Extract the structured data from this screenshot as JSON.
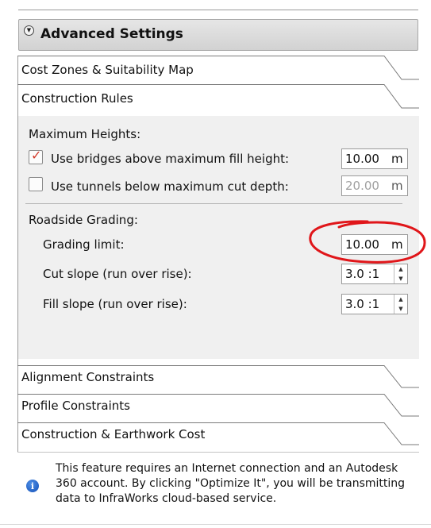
{
  "advanced_settings": {
    "title": "Advanced Settings",
    "toggle_icon": "double-chevron-down-icon"
  },
  "sections": [
    {
      "id": "cost-zones",
      "title": "Cost Zones & Suitability Map"
    },
    {
      "id": "construction-rules",
      "title": "Construction Rules"
    },
    {
      "id": "alignment-constraints",
      "title": "Alignment Constraints"
    },
    {
      "id": "profile-constraints",
      "title": "Profile Constraints"
    },
    {
      "id": "construction-earthwork",
      "title": "Construction & Earthwork Cost"
    }
  ],
  "construction_rules": {
    "max_heights": {
      "heading": "Maximum Heights:",
      "bridges": {
        "label": "Use bridges above maximum fill height:",
        "checked": true,
        "value": "10.00",
        "unit": "m"
      },
      "tunnels": {
        "label": "Use tunnels below maximum cut depth:",
        "checked": false,
        "value": "20.00",
        "unit": "m",
        "disabled": true
      }
    },
    "roadside_grading": {
      "heading": "Roadside Grading:",
      "grading_limit": {
        "label": "Grading limit:",
        "value": "10.00",
        "unit": "m"
      },
      "cut_slope": {
        "label": "Cut slope (run over rise):",
        "value": "3.0 :1"
      },
      "fill_slope": {
        "label": "Fill slope (run over rise):",
        "value": "3.0 :1"
      }
    }
  },
  "info": {
    "icon": "info-icon",
    "text": "This feature requires an Internet connection and an Autodesk 360 account. By clicking \"Optimize It\", you will be transmitting data to InfraWorks cloud-based service."
  },
  "colors": {
    "annotation_circle": "#e0161a",
    "checkmark": "#d23a2a",
    "panel_background": "#f0f0f0",
    "info_icon": "#1a5ccf"
  }
}
